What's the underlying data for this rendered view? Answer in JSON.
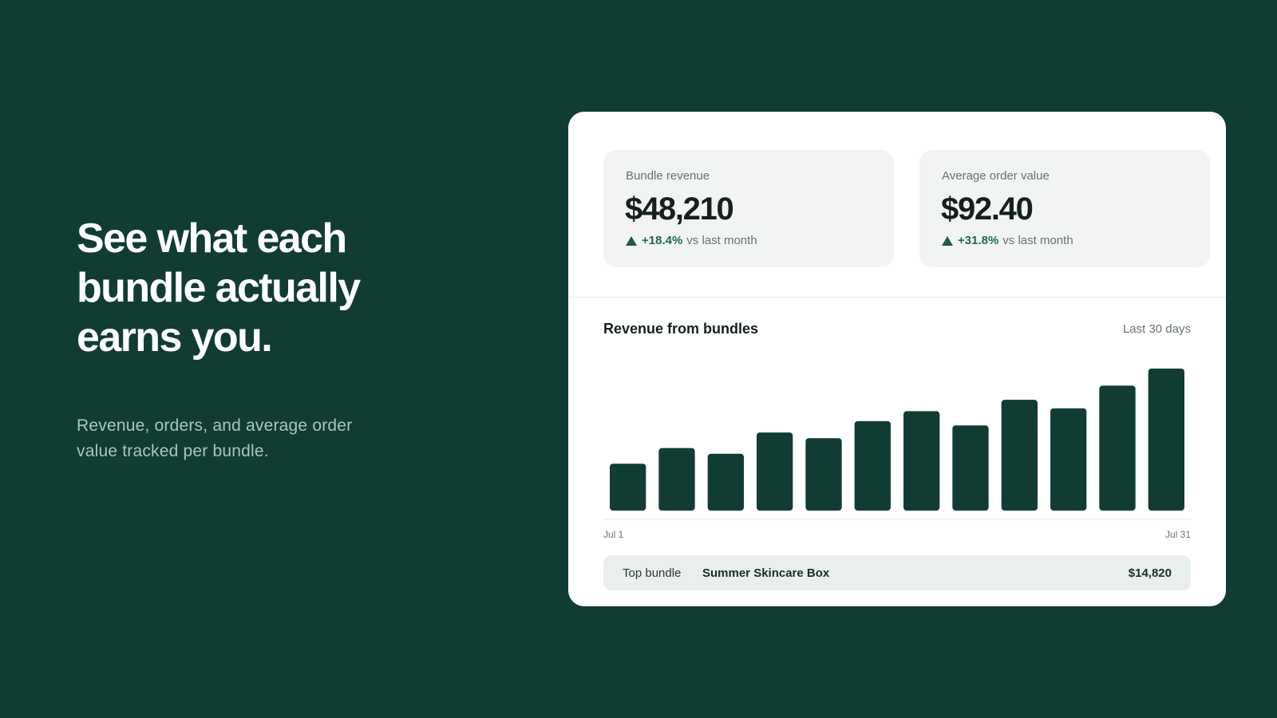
{
  "hero": {
    "heading_lines": [
      "See what each",
      "bundle actually",
      "earns you."
    ],
    "subtext": "Revenue, orders, and average order value tracked per bundle."
  },
  "stats": [
    {
      "label": "Bundle revenue",
      "value": "$48,210",
      "change": "+18.4%",
      "change_suffix": "vs last month"
    },
    {
      "label": "Average order value",
      "value": "$92.40",
      "change": "+31.8%",
      "change_suffix": "vs last month"
    }
  ],
  "chart_section": {
    "title": "Revenue from bundles",
    "range": "Last 30 days"
  },
  "chart_data": {
    "type": "bar",
    "title": "Revenue from bundles",
    "x_start_label": "Jul 1",
    "x_end_label": "Jul 31",
    "values": [
      33,
      44,
      40,
      55,
      51,
      63,
      70,
      60,
      78,
      72,
      88,
      100
    ],
    "ylim": [
      0,
      100
    ],
    "grid": false,
    "bar_color": "#113c34"
  },
  "top_bundle": {
    "label": "Top bundle",
    "name": "Summer Skincare Box",
    "value": "$14,820"
  },
  "colors": {
    "background": "#113c34",
    "accent_positive": "#1d6b4d"
  }
}
